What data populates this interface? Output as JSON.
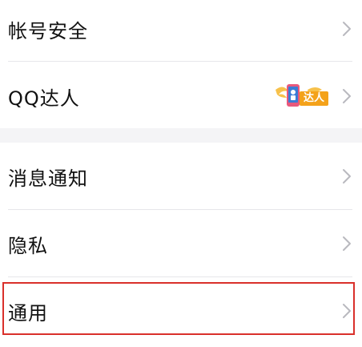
{
  "settings": {
    "group1": [
      {
        "label": "帐号安全"
      },
      {
        "label": "QQ达人",
        "badge": "达人"
      }
    ],
    "group2": [
      {
        "label": "消息通知"
      },
      {
        "label": "隐私"
      },
      {
        "label": "通用"
      }
    ]
  },
  "colors": {
    "accent_highlight": "#d9302b",
    "badge_orange": "#f4a21a",
    "page_bg": "#f4f4f6"
  }
}
